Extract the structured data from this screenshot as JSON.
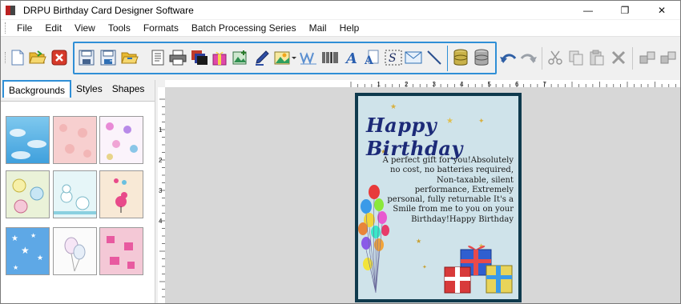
{
  "window": {
    "title": "DRPU Birthday Card Designer Software",
    "controls": {
      "minimize": "—",
      "maximize": "❐",
      "close": "✕"
    }
  },
  "menu": {
    "items": [
      "File",
      "Edit",
      "View",
      "Tools",
      "Formats",
      "Batch Processing Series",
      "Mail",
      "Help"
    ]
  },
  "toolbar": {
    "buttons": [
      "new-icon",
      "open-icon",
      "close-icon",
      "save-icon",
      "save-as-icon",
      "export-icon",
      "print-preview-icon",
      "print-icon",
      "copy-design-icon",
      "gift-icon",
      "image-insert-icon",
      "pen-icon",
      "picture-icon",
      "watermark-icon",
      "barcode-icon",
      "text-icon",
      "text-box-icon",
      "signature-icon",
      "mail-icon",
      "line-icon",
      "database-icon",
      "database-2-icon",
      "undo-icon",
      "redo-icon",
      "cut-icon",
      "copy-icon",
      "paste-icon",
      "delete-icon",
      "align-icon",
      "group-icon"
    ]
  },
  "left_panel": {
    "tabs": [
      "Backgrounds",
      "Styles",
      "Shapes"
    ],
    "active_tab": "Backgrounds",
    "thumbnails": [
      "blue-clouds",
      "pink-pattern",
      "butterflies",
      "flowers",
      "snowmen",
      "birds",
      "blue-stars",
      "balloons-sketch",
      "pink-gifts"
    ]
  },
  "ruler": {
    "labels": [
      "1",
      "2",
      "3",
      "4",
      "5",
      "6",
      "7"
    ],
    "vertical_labels": [
      "1",
      "2",
      "3",
      "4"
    ]
  },
  "card": {
    "title": "Happy Birthday",
    "message": "A perfect gift for you!Absolutely no cost, no batteries required, Non-taxable, silent performance, Extremely personal, fully returnable It's a Smile from me to you on your Birthday!Happy Birthday"
  },
  "colors": {
    "highlight": "#2f8fd6",
    "card_border": "#0f3a4d",
    "card_title": "#1c2a78"
  }
}
